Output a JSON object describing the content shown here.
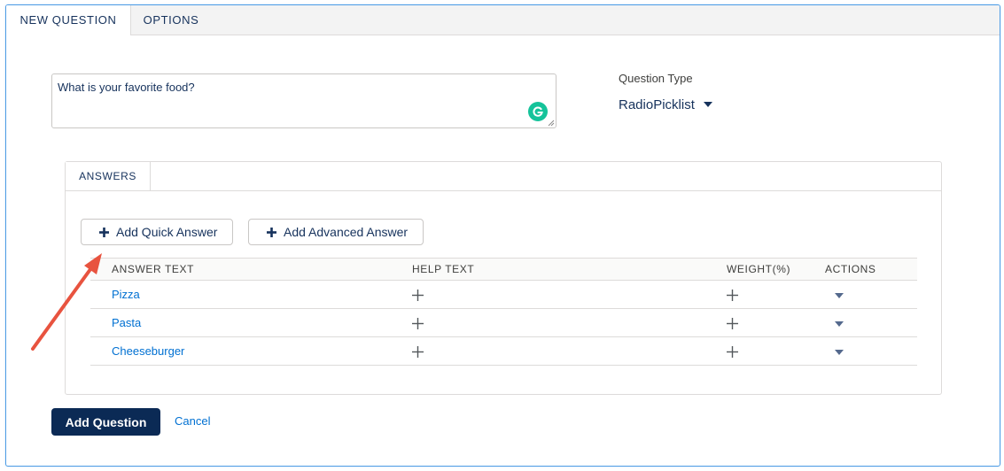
{
  "tabs": [
    {
      "label": "NEW QUESTION",
      "active": true
    },
    {
      "label": "OPTIONS",
      "active": false
    }
  ],
  "question": {
    "text": "What is your favorite food?",
    "type_label": "Question Type",
    "type_value": "RadioPicklist"
  },
  "answers": {
    "tab_label": "ANSWERS",
    "add_quick_label": "Add Quick Answer",
    "add_advanced_label": "Add Advanced Answer",
    "columns": [
      "ANSWER TEXT",
      "HELP TEXT",
      "WEIGHT(%)",
      "ACTIONS"
    ],
    "rows": [
      {
        "text": "Pizza"
      },
      {
        "text": "Pasta"
      },
      {
        "text": "Cheeseburger"
      }
    ]
  },
  "footer": {
    "add_question_label": "Add Question",
    "cancel_label": "Cancel"
  },
  "colors": {
    "frame_border": "#4f9de5",
    "link": "#0070d2",
    "primary_button": "#0b2a55",
    "annotation_arrow": "#e8533f",
    "grammarly": "#15c39a"
  },
  "icons": {
    "add": "plus-icon",
    "dropdown": "caret-down-icon",
    "grammarly": "grammarly-icon",
    "annotation": "arrow-annotation"
  }
}
